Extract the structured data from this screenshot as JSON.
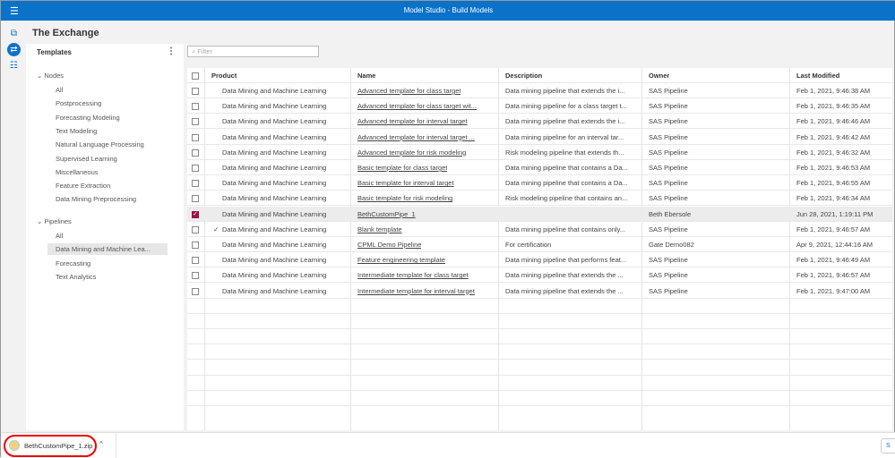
{
  "app": {
    "title": "Model Studio - Build Models",
    "page_title": "The Exchange"
  },
  "left_panel": {
    "heading": "Templates",
    "groups": [
      {
        "label": "Nodes",
        "items": [
          "All",
          "Postprocessing",
          "Forecasting Modeling",
          "Text Modeling",
          "Natural Language Processing",
          "Supervised Learning",
          "Miscellaneous",
          "Feature Extraction",
          "Data Mining Preprocessing"
        ]
      },
      {
        "label": "Pipelines",
        "items": [
          "All",
          "Data Mining and Machine Lea...",
          "Forecasting",
          "Text Analytics"
        ],
        "selected": 1
      }
    ]
  },
  "filter": {
    "placeholder": "Filter"
  },
  "table": {
    "columns": [
      "Product",
      "Name",
      "Description",
      "Owner",
      "Last Modified"
    ],
    "rows": [
      {
        "checked": false,
        "mark": "",
        "product": "Data Mining and Machine Learning",
        "name": "Advanced template for class target",
        "description": "Data mining pipeline that extends the i...",
        "owner": "SAS Pipeline",
        "modified": "Feb 1, 2021, 9:46:38 AM"
      },
      {
        "checked": false,
        "mark": "",
        "product": "Data Mining and Machine Learning",
        "name": "Advanced template for class target wit...",
        "description": "Data mining pipeline for a class target t...",
        "owner": "SAS Pipeline",
        "modified": "Feb 1, 2021, 9:46:35 AM"
      },
      {
        "checked": false,
        "mark": "",
        "product": "Data Mining and Machine Learning",
        "name": "Advanced template for interval target",
        "description": "Data mining pipeline that extends the i...",
        "owner": "SAS Pipeline",
        "modified": "Feb 1, 2021, 9:46:46 AM"
      },
      {
        "checked": false,
        "mark": "",
        "product": "Data Mining and Machine Learning",
        "name": "Advanced template for interval target ...",
        "description": "Data mining pipeline for an interval tar...",
        "owner": "SAS Pipeline",
        "modified": "Feb 1, 2021, 9:46:42 AM"
      },
      {
        "checked": false,
        "mark": "",
        "product": "Data Mining and Machine Learning",
        "name": "Advanced template for risk modeling",
        "description": "Risk modeling pipeline that extends th...",
        "owner": "SAS Pipeline",
        "modified": "Feb 1, 2021, 9:46:32 AM"
      },
      {
        "checked": false,
        "mark": "",
        "product": "Data Mining and Machine Learning",
        "name": "Basic template for class target",
        "description": "Data mining pipeline that contains a Da...",
        "owner": "SAS Pipeline",
        "modified": "Feb 1, 2021, 9:46:53 AM"
      },
      {
        "checked": false,
        "mark": "",
        "product": "Data Mining and Machine Learning",
        "name": "Basic template for interval target",
        "description": "Data mining pipeline that contains a Da...",
        "owner": "SAS Pipeline",
        "modified": "Feb 1, 2021, 9:46:55 AM"
      },
      {
        "checked": false,
        "mark": "",
        "product": "Data Mining and Machine Learning",
        "name": "Basic template for risk modeling",
        "description": "Risk modeling pipeline that contains an...",
        "owner": "SAS Pipeline",
        "modified": "Feb 1, 2021, 9:46:34 AM"
      },
      {
        "checked": true,
        "mark": "",
        "product": "Data Mining and Machine Learning",
        "name": "BethCustomPipe_1",
        "description": "",
        "owner": "Beth Ebersole",
        "modified": "Jun 28, 2021, 1:19:11 PM"
      },
      {
        "checked": false,
        "mark": "✓",
        "product": "Data Mining and Machine Learning",
        "name": "Blank template",
        "description": "Data mining pipeline that contains only...",
        "owner": "SAS Pipeline",
        "modified": "Feb 1, 2021, 9:46:57 AM"
      },
      {
        "checked": false,
        "mark": "",
        "product": "Data Mining and Machine Learning",
        "name": "CPML Demo Pipeline",
        "description": "For certification",
        "owner": "Gate Demo082",
        "modified": "Apr 9, 2021, 12:44:16 AM"
      },
      {
        "checked": false,
        "mark": "",
        "product": "Data Mining and Machine Learning",
        "name": "Feature engineering template",
        "description": "Data mining pipeline that performs feat...",
        "owner": "SAS Pipeline",
        "modified": "Feb 1, 2021, 9:46:49 AM"
      },
      {
        "checked": false,
        "mark": "",
        "product": "Data Mining and Machine Learning",
        "name": "Intermediate template for class target",
        "description": "Data mining pipeline that extends the ...",
        "owner": "SAS Pipeline",
        "modified": "Feb 1, 2021, 9:46:57 AM"
      },
      {
        "checked": false,
        "mark": "",
        "product": "Data Mining and Machine Learning",
        "name": "Intermediate template for interval target",
        "description": "Data mining pipeline that extends the ...",
        "owner": "SAS Pipeline",
        "modified": "Feb 1, 2021, 9:47:00 AM"
      }
    ]
  },
  "download_bar": {
    "file": "BethCustomPipe_1.zip",
    "show_all": "S"
  },
  "colors": {
    "accent": "#0a72c8",
    "checked": "#9b1048",
    "highlight_ring": "#e00000"
  }
}
